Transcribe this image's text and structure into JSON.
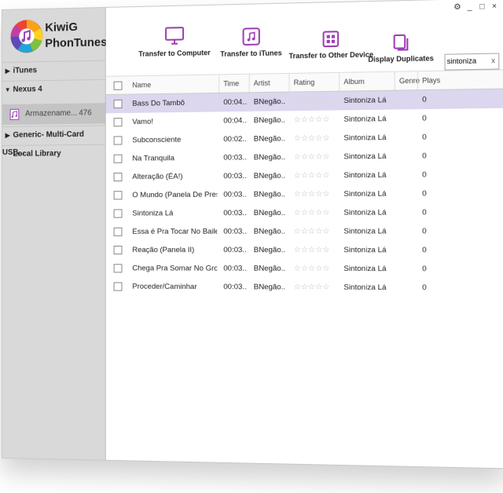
{
  "app": {
    "name_line1": "KiwiG",
    "name_line2": "PhonTunes"
  },
  "window_controls": {
    "settings": "⚙",
    "minimize": "_",
    "maximize": "□",
    "close": "×"
  },
  "sidebar": {
    "itunes": "iTunes",
    "device": "Nexus 4",
    "storage_label": "Armazename...",
    "storage_count": "476",
    "generic": "Generic- Multi-Card USB...",
    "local": "Local Library"
  },
  "toolbar": {
    "transfer_computer": "Transfer to Computer",
    "transfer_itunes": "Transfer to iTunes",
    "transfer_other": "Transfer to Other Device",
    "display_duplicates": "Display Duplicates"
  },
  "search": {
    "value": "sintoniza",
    "clear": "x"
  },
  "columns": [
    "Name",
    "Time",
    "Artist",
    "Rating",
    "Album",
    "Genre",
    "Plays"
  ],
  "rows": [
    {
      "name": "Bass Do Tambô",
      "time": "00:04...",
      "artist": "BNegão...",
      "album": "Sintoniza Lá",
      "plays": "0",
      "selected": true
    },
    {
      "name": "Vamo!",
      "time": "00:04...",
      "artist": "BNegão...",
      "album": "Sintoniza Lá",
      "plays": "0"
    },
    {
      "name": "Subconsciente",
      "time": "00:02...",
      "artist": "BNegão...",
      "album": "Sintoniza Lá",
      "plays": "0"
    },
    {
      "name": "Na Tranquila",
      "time": "00:03...",
      "artist": "BNegão...",
      "album": "Sintoniza Lá",
      "plays": "0"
    },
    {
      "name": "Alteração (ÉA!)",
      "time": "00:03...",
      "artist": "BNegão...",
      "album": "Sintoniza Lá",
      "plays": "0"
    },
    {
      "name": "O Mundo (Panela De Pres...",
      "time": "00:03...",
      "artist": "BNegão...",
      "album": "Sintoniza Lá",
      "plays": "0"
    },
    {
      "name": "Sintoniza Lá",
      "time": "00:03...",
      "artist": "BNegão...",
      "album": "Sintoniza Lá",
      "plays": "0"
    },
    {
      "name": "Essa é Pra Tocar No Baile",
      "time": "00:03...",
      "artist": "BNegão...",
      "album": "Sintoniza Lá",
      "plays": "0"
    },
    {
      "name": "Reação (Panela II)",
      "time": "00:03...",
      "artist": "BNegão...",
      "album": "Sintoniza Lá",
      "plays": "0"
    },
    {
      "name": "Chega Pra Somar No Gro...",
      "time": "00:03...",
      "artist": "BNegão...",
      "album": "Sintoniza Lá",
      "plays": "0"
    },
    {
      "name": "Proceder/Caminhar",
      "time": "00:03...",
      "artist": "BNegão...",
      "album": "Sintoniza Lá",
      "plays": "0"
    }
  ],
  "rating_stars": "☆☆☆☆☆",
  "colors": {
    "accent": "#9c3fb4",
    "selected_row": "#dcd6ee",
    "sidebar_bg": "#d9d9d9"
  }
}
